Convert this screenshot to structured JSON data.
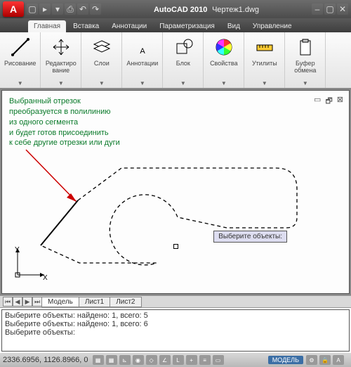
{
  "titlebar": {
    "app_name": "AutoCAD 2010",
    "document": "Чертеж1.dwg"
  },
  "tabs": {
    "items": [
      "Главная",
      "Вставка",
      "Аннотации",
      "Параметризация",
      "Вид",
      "Управление"
    ],
    "active": 0
  },
  "ribbon": {
    "panels": [
      {
        "label": "Рисование",
        "icon": "line-icon"
      },
      {
        "label": "Редактиро\nвание",
        "icon": "move-icon"
      },
      {
        "label": "Слои",
        "icon": "layers-icon"
      },
      {
        "label": "Аннотации",
        "icon": "text-icon"
      },
      {
        "label": "Блок",
        "icon": "block-icon"
      },
      {
        "label": "Свойства",
        "icon": "color-wheel-icon"
      },
      {
        "label": "Утилиты",
        "icon": "measure-icon"
      },
      {
        "label": "Буфер\nобмена",
        "icon": "clipboard-icon"
      }
    ]
  },
  "canvas": {
    "note_lines": [
      "Выбранный отрезок",
      "преобразуется в полилинию",
      "из одного сегмента",
      "и будет готов присоединить",
      "к себе другие отрезки или дуги"
    ],
    "axis_y": "Y",
    "axis_x": "X",
    "prompt": "Выберите объекты:"
  },
  "sheets": {
    "tabs": [
      "Модель",
      "Лист1",
      "Лист2"
    ],
    "active": 0
  },
  "command_window": {
    "lines": [
      "Выберите объекты: найдено: 1, всего: 5",
      "Выберите объекты: найдено: 1, всего: 6",
      "",
      "Выберите объекты:"
    ]
  },
  "status": {
    "coords": "2336.6956, 1126.8966, 0",
    "mode": "МОДЕЛЬ"
  }
}
